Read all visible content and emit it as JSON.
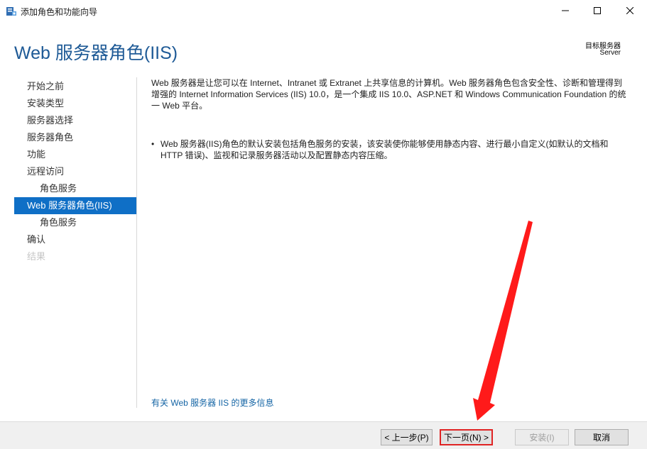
{
  "window": {
    "title": "添加角色和功能向导",
    "icons": {
      "app": "server-manager-icon",
      "minimize": "minimize-icon",
      "maximize": "maximize-icon",
      "close": "close-icon"
    }
  },
  "header": {
    "page_title": "Web 服务器角色(IIS)",
    "target_label": "目标服务器",
    "target_value": "Server"
  },
  "nav": {
    "items": [
      {
        "label": "开始之前",
        "state": "normal",
        "level": 0
      },
      {
        "label": "安装类型",
        "state": "normal",
        "level": 0
      },
      {
        "label": "服务器选择",
        "state": "normal",
        "level": 0
      },
      {
        "label": "服务器角色",
        "state": "normal",
        "level": 0
      },
      {
        "label": "功能",
        "state": "normal",
        "level": 0
      },
      {
        "label": "远程访问",
        "state": "normal",
        "level": 0
      },
      {
        "label": "角色服务",
        "state": "normal",
        "level": 1
      },
      {
        "label": "Web 服务器角色(IIS)",
        "state": "active",
        "level": 0
      },
      {
        "label": "角色服务",
        "state": "normal",
        "level": 1
      },
      {
        "label": "确认",
        "state": "normal",
        "level": 0
      },
      {
        "label": "结果",
        "state": "disabled",
        "level": 0
      }
    ]
  },
  "content": {
    "description": "Web 服务器是让您可以在 Internet、Intranet 或 Extranet 上共享信息的计算机。Web 服务器角色包含安全性、诊断和管理得到增强的 Internet Information Services (IIS) 10.0，是一个集成 IIS 10.0、ASP.NET 和 Windows Communication Foundation 的统一 Web 平台。",
    "bullet_symbol": "•",
    "bullets": [
      "Web 服务器(IIS)角色的默认安装包括角色服务的安装，该安装使你能够使用静态内容、进行最小自定义(如默认的文档和 HTTP 错误)、监视和记录服务器活动以及配置静态内容压缩。"
    ],
    "more_link": "有关 Web 服务器 IIS 的更多信息"
  },
  "footer": {
    "prev_label": "< 上一步(P)",
    "next_label": "下一页(N) >",
    "install_label": "安装(I)",
    "cancel_label": "取消"
  },
  "colors": {
    "accent": "#0f6fc6",
    "title_blue": "#1e5a96",
    "annotation_red": "#e02424"
  }
}
